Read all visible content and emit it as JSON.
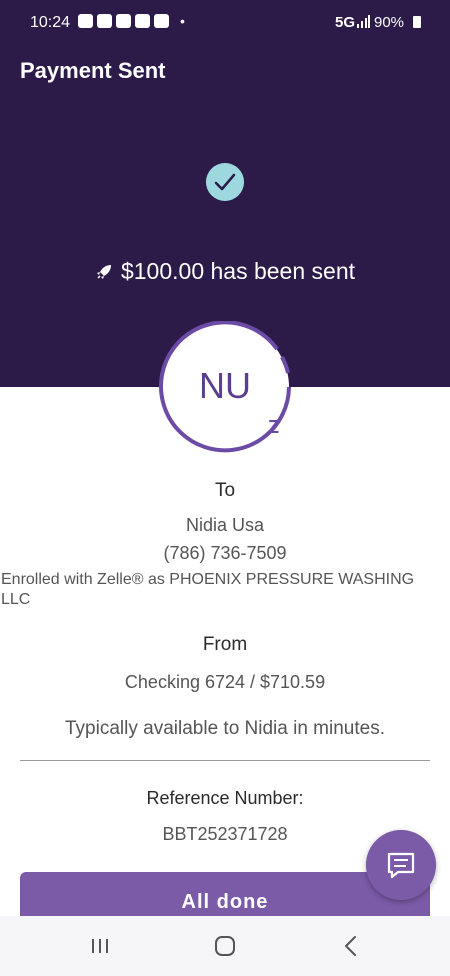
{
  "status_bar": {
    "time": "10:24",
    "network": "5G",
    "battery": "90%",
    "notification_icons": [
      "news-app-icon",
      "news-app-icon",
      "news-app-icon",
      "lock-app-icon",
      "n-app-icon"
    ]
  },
  "header": {
    "title": "Payment Sent",
    "sent_message": "$100.00 has been sent",
    "background_color": "#2c1b49",
    "check_color": "#9ed8df",
    "icons": [
      "check-icon",
      "rocket-icon"
    ]
  },
  "recipient": {
    "initials": "NU",
    "zelle_mark": "Z",
    "to_label": "To",
    "name": "Nidia Usa",
    "phone": "(786) 736-7509",
    "enrolled_text": "Enrolled with Zelle® as PHOENIX PRESSURE WASHING LLC"
  },
  "source": {
    "from_label": "From",
    "account": "Checking 6724 / $710.59",
    "availability": "Typically available to Nidia in minutes."
  },
  "reference": {
    "label": "Reference Number:",
    "number": "BBT252371728"
  },
  "actions": {
    "done_label": "All done",
    "accent_color": "#7b5ba8",
    "chat_icon": "chat-icon"
  },
  "nav_bar": {
    "buttons": [
      "recent-apps-icon",
      "home-icon",
      "back-icon"
    ]
  }
}
